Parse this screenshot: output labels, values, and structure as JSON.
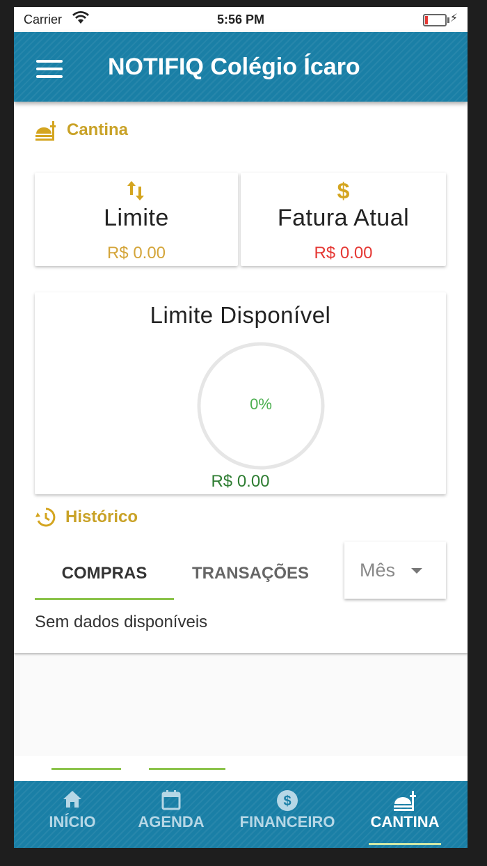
{
  "status_bar": {
    "carrier": "Carrier",
    "time": "5:56 PM"
  },
  "app_bar": {
    "title": "NOTIFIQ Colégio Ícaro"
  },
  "sections": {
    "cantina": "Cantina",
    "historico": "Histórico"
  },
  "cards": {
    "limite": {
      "label": "Limite",
      "value": "R$ 0.00"
    },
    "fatura": {
      "label": "Fatura Atual",
      "value": "R$ 0.00"
    },
    "disponivel": {
      "label": "Limite Disponível",
      "percent": "0%",
      "value": "R$ 0.00",
      "progress": 0
    }
  },
  "history_tabs": [
    {
      "label": "COMPRAS",
      "active": true
    },
    {
      "label": "TRANSAÇÕES",
      "active": false
    }
  ],
  "period_select": {
    "value": "Mês"
  },
  "empty_message": "Sem dados disponíveis",
  "bottom_nav": [
    {
      "label": "INÍCIO",
      "icon": "home-icon",
      "active": false
    },
    {
      "label": "AGENDA",
      "icon": "calendar-icon",
      "active": false
    },
    {
      "label": "FINANCEIRO",
      "icon": "dollar-circle-icon",
      "active": false
    },
    {
      "label": "CANTINA",
      "icon": "food-icon",
      "active": true
    }
  ],
  "colors": {
    "primary": "#1a7fa6",
    "gold": "#c9a227",
    "green": "#4caf50",
    "red": "#e53935",
    "accent_green": "#8bc34a"
  }
}
